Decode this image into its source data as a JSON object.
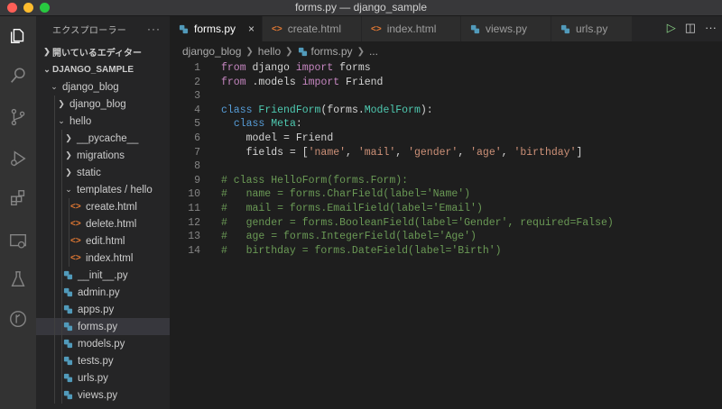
{
  "window": {
    "title": "forms.py — django_sample"
  },
  "activity_bar": {
    "icons": [
      "explorer-icon",
      "search-icon",
      "source-control-icon",
      "run-debug-icon",
      "extensions-icon",
      "remote-explorer-icon",
      "testing-icon",
      "git-graph-icon"
    ]
  },
  "sidebar": {
    "header": "エクスプローラー",
    "more": "···",
    "open_editors": "開いているエディター",
    "project": "DJANGO_SAMPLE",
    "tree": [
      {
        "label": "django_blog",
        "kind": "folder",
        "open": true,
        "depth": 1
      },
      {
        "label": "django_blog",
        "kind": "folder",
        "open": false,
        "depth": 2
      },
      {
        "label": "hello",
        "kind": "folder",
        "open": true,
        "depth": 2
      },
      {
        "label": "__pycache__",
        "kind": "folder",
        "open": false,
        "depth": 3
      },
      {
        "label": "migrations",
        "kind": "folder",
        "open": false,
        "depth": 3
      },
      {
        "label": "static",
        "kind": "folder",
        "open": false,
        "depth": 3
      },
      {
        "label": "templates / hello",
        "kind": "folder",
        "open": true,
        "depth": 3
      },
      {
        "label": "create.html",
        "kind": "html",
        "depth": 4
      },
      {
        "label": "delete.html",
        "kind": "html",
        "depth": 4
      },
      {
        "label": "edit.html",
        "kind": "html",
        "depth": 4
      },
      {
        "label": "index.html",
        "kind": "html",
        "depth": 4
      },
      {
        "label": "__init__.py",
        "kind": "py",
        "depth": 3
      },
      {
        "label": "admin.py",
        "kind": "py",
        "depth": 3
      },
      {
        "label": "apps.py",
        "kind": "py",
        "depth": 3
      },
      {
        "label": "forms.py",
        "kind": "py",
        "depth": 3,
        "active": true
      },
      {
        "label": "models.py",
        "kind": "py",
        "depth": 3
      },
      {
        "label": "tests.py",
        "kind": "py",
        "depth": 3
      },
      {
        "label": "urls.py",
        "kind": "py",
        "depth": 3
      },
      {
        "label": "views.py",
        "kind": "py",
        "depth": 3
      }
    ]
  },
  "tabs": [
    {
      "label": "forms.py",
      "kind": "py",
      "active": true,
      "close": "×"
    },
    {
      "label": "create.html",
      "kind": "html"
    },
    {
      "label": "index.html",
      "kind": "html"
    },
    {
      "label": "views.py",
      "kind": "py"
    },
    {
      "label": "urls.py",
      "kind": "py"
    }
  ],
  "breadcrumb": [
    "django_blog",
    "hello",
    "forms.py",
    "..."
  ],
  "editor": {
    "lines": [
      [
        {
          "t": "from ",
          "c": "kw"
        },
        {
          "t": "django ",
          "c": ""
        },
        {
          "t": "import ",
          "c": "kw"
        },
        {
          "t": "forms",
          "c": ""
        }
      ],
      [
        {
          "t": "from ",
          "c": "kw"
        },
        {
          "t": ".models ",
          "c": ""
        },
        {
          "t": "import ",
          "c": "kw"
        },
        {
          "t": "Friend",
          "c": ""
        }
      ],
      [],
      [
        {
          "t": "class ",
          "c": "kw2"
        },
        {
          "t": "FriendForm",
          "c": "cls"
        },
        {
          "t": "(forms.",
          "c": ""
        },
        {
          "t": "ModelForm",
          "c": "cls"
        },
        {
          "t": "):",
          "c": ""
        }
      ],
      [
        {
          "t": "  ",
          "c": "dots"
        },
        {
          "t": "class ",
          "c": "kw2"
        },
        {
          "t": "Meta",
          "c": "cls"
        },
        {
          "t": ":",
          "c": ""
        }
      ],
      [
        {
          "t": "    ",
          "c": "dots"
        },
        {
          "t": "model = Friend",
          "c": ""
        }
      ],
      [
        {
          "t": "    ",
          "c": "dots"
        },
        {
          "t": "fields = [",
          "c": ""
        },
        {
          "t": "'name'",
          "c": "str"
        },
        {
          "t": ", ",
          "c": ""
        },
        {
          "t": "'mail'",
          "c": "str"
        },
        {
          "t": ", ",
          "c": ""
        },
        {
          "t": "'gender'",
          "c": "str"
        },
        {
          "t": ", ",
          "c": ""
        },
        {
          "t": "'age'",
          "c": "str"
        },
        {
          "t": ", ",
          "c": ""
        },
        {
          "t": "'birthday'",
          "c": "str"
        },
        {
          "t": "]",
          "c": ""
        }
      ],
      [],
      [
        {
          "t": "# class HelloForm(forms.Form):",
          "c": "cmt"
        }
      ],
      [
        {
          "t": "#   name = forms.CharField(label='Name')",
          "c": "cmt"
        }
      ],
      [
        {
          "t": "#   mail = forms.EmailField(label='Email')",
          "c": "cmt"
        }
      ],
      [
        {
          "t": "#   gender = forms.BooleanField(label='Gender', required=False)",
          "c": "cmt"
        }
      ],
      [
        {
          "t": "#   age = forms.IntegerField(label='Age')",
          "c": "cmt"
        }
      ],
      [
        {
          "t": "#   birthday = forms.DateField(label='Birth')",
          "c": "cmt"
        }
      ]
    ]
  },
  "colors": {
    "python_icon": "#519aba",
    "html_icon": "#e37933",
    "run": "#89d185"
  }
}
